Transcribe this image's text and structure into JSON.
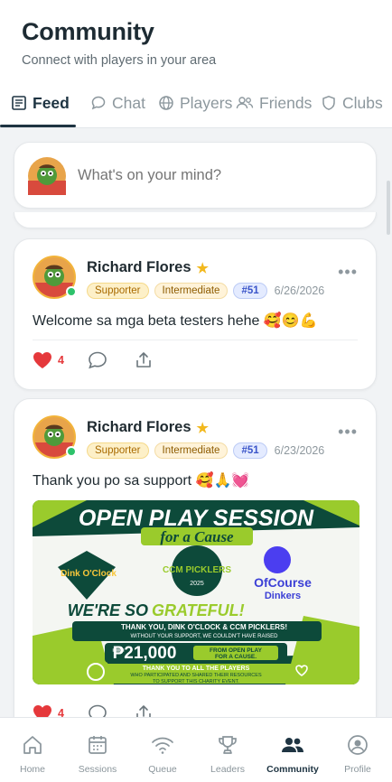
{
  "header": {
    "title": "Community",
    "subtitle": "Connect with players in your area"
  },
  "tabs": [
    {
      "label": "Feed",
      "icon": "feed-icon",
      "active": true
    },
    {
      "label": "Chat",
      "icon": "chat-bubble-icon"
    },
    {
      "label": "Players",
      "icon": "globe-icon"
    },
    {
      "label": "Friends",
      "icon": "friends-icon"
    },
    {
      "label": "Clubs",
      "icon": "shield-icon"
    }
  ],
  "composer": {
    "placeholder": "What's on your mind?"
  },
  "posts": [
    {
      "author": "Richard Flores",
      "badges": [
        "Supporter",
        "Intermediate"
      ],
      "rank": "#51",
      "date": "6/26/2026",
      "text": "Welcome sa mga beta testers hehe 🥰😊💪",
      "likes": "4",
      "more": "•••"
    },
    {
      "author": "Richard Flores",
      "badges": [
        "Supporter",
        "Intermediate"
      ],
      "rank": "#51",
      "date": "6/23/2026",
      "text": "Thank you po sa support 🥰🙏💓",
      "likes": "4",
      "more": "•••",
      "poster": {
        "title": "OPEN PLAY SESSION",
        "subtitle": "for a Cause",
        "logo1": "Dink O'Clock",
        "logo2": "CCM PICKLERS",
        "logo2_year": "2025",
        "logo3_top": "OfCourse",
        "logo3_bottom": "Dinkers",
        "headline_a": "WE'RE SO",
        "headline_b": "GRATEFUL!",
        "thanks": "THANK YOU, DINK O'CLOCK & CCM PICKLERS!",
        "thanks_sub": "WITHOUT YOUR SUPPORT, WE COULDN'T HAVE RAISED",
        "amount": "₱21,000",
        "amount_note_1": "FROM OPEN PLAY",
        "amount_note_2": "FOR A CAUSE.",
        "footer_1": "THANK YOU TO ALL THE PLAYERS",
        "footer_2": "WHO PARTICIPATED AND SHARED THEIR RESOURCES",
        "footer_3": "TO SUPPORT THIS CHARITY EVENT."
      }
    }
  ],
  "nav": [
    {
      "label": "Home",
      "icon": "home-icon"
    },
    {
      "label": "Sessions",
      "icon": "calendar-icon"
    },
    {
      "label": "Queue",
      "icon": "wifi-icon"
    },
    {
      "label": "Leaders",
      "icon": "trophy-icon"
    },
    {
      "label": "Community",
      "icon": "community-icon",
      "active": true
    },
    {
      "label": "Profile",
      "icon": "profile-icon"
    }
  ],
  "colors": {
    "primary": "#1e3442",
    "like": "#e5383b",
    "online": "#2ec26b",
    "poster_green": "#0d4a3a",
    "poster_lime": "#9acb2c"
  }
}
